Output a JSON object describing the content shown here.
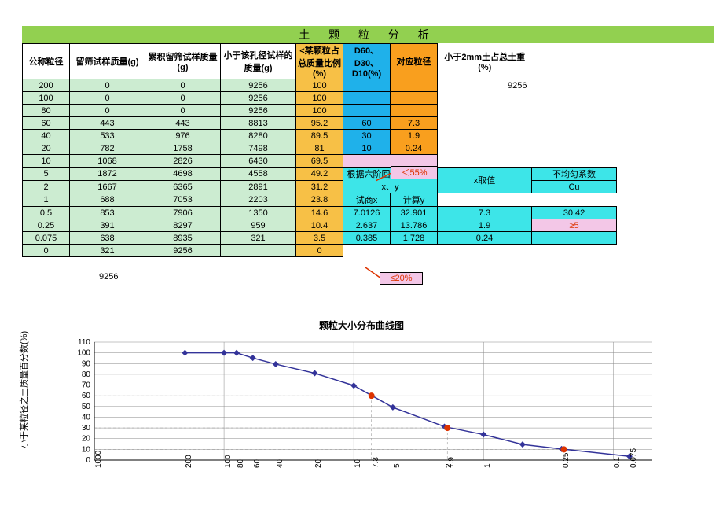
{
  "title": "土 颗 粒 分 析",
  "headers": {
    "nominal": "公称粒径",
    "retained": "留筛试样质量(g)",
    "cumretained": "累积留筛试样质量(g)",
    "passing": "小于该孔径试样的质量(g)",
    "pct": "<某颗粒占总质量比例(%)",
    "d": "D60、D30、D10(%)",
    "dia": "对应粒径",
    "soil": "小于2mm土占总土重(%)"
  },
  "total_under_header": "9256",
  "rows": [
    {
      "nom": "200",
      "ret": "0",
      "cum": "0",
      "pass": "9256",
      "pct": "100",
      "d": "",
      "dia": ""
    },
    {
      "nom": "100",
      "ret": "0",
      "cum": "0",
      "pass": "9256",
      "pct": "100",
      "d": "",
      "dia": ""
    },
    {
      "nom": "80",
      "ret": "0",
      "cum": "0",
      "pass": "9256",
      "pct": "100",
      "d": "",
      "dia": ""
    },
    {
      "nom": "60",
      "ret": "443",
      "cum": "443",
      "pass": "8813",
      "pct": "95.2",
      "d": "60",
      "dia": "7.3"
    },
    {
      "nom": "40",
      "ret": "533",
      "cum": "976",
      "pass": "8280",
      "pct": "89.5",
      "d": "30",
      "dia": "1.9"
    },
    {
      "nom": "20",
      "ret": "782",
      "cum": "1758",
      "pass": "7498",
      "pct": "81",
      "d": "10",
      "dia": "0.24"
    },
    {
      "nom": "10",
      "ret": "1068",
      "cum": "2826",
      "pass": "6430",
      "pct": "69.5",
      "d": "",
      "dia": ""
    },
    {
      "nom": "5",
      "ret": "1872",
      "cum": "4698",
      "pass": "4558",
      "pct": "49.2",
      "d": "",
      "dia": ""
    },
    {
      "nom": "2",
      "ret": "1667",
      "cum": "6365",
      "pass": "2891",
      "pct": "31.2",
      "d": "",
      "dia": ""
    },
    {
      "nom": "1",
      "ret": "688",
      "cum": "7053",
      "pass": "2203",
      "pct": "23.8",
      "d": "",
      "dia": ""
    },
    {
      "nom": "0.5",
      "ret": "853",
      "cum": "7906",
      "pass": "1350",
      "pct": "14.6",
      "d": "",
      "dia": ""
    },
    {
      "nom": "0.25",
      "ret": "391",
      "cum": "8297",
      "pass": "959",
      "pct": "10.4",
      "d": "",
      "dia": ""
    },
    {
      "nom": "0.075",
      "ret": "638",
      "cum": "8935",
      "pass": "321",
      "pct": "3.5",
      "d": "",
      "dia": ""
    },
    {
      "nom": "0",
      "ret": "321",
      "cum": "9256",
      "pass": "",
      "pct": "0",
      "d": "",
      "dia": ""
    }
  ],
  "sum_label": "9256",
  "regression_hdr": "根据六阶回归方程计算x、y",
  "trialx_hdr": "试商x",
  "calcy_hdr": "计算y",
  "xvalue_hdr": "x取值",
  "cu_hdr1": "不均匀系数",
  "cu_hdr2": "Cu",
  "calc_rows": [
    {
      "x": "7.0126",
      "y": "32.901",
      "xv": "7.3",
      "cu": "30.42"
    },
    {
      "x": "2.637",
      "y": "13.786",
      "xv": "1.9",
      "cu": "≥5"
    },
    {
      "x": "0.385",
      "y": "1.728",
      "xv": "0.24",
      "cu": ""
    }
  ],
  "annot_55": "＜55%",
  "annot_20": "≤20%",
  "chart_title": "颗粒大小分布曲线图",
  "y_axis_label": "小于某粒径之土质量百分数(%)",
  "chart_data": {
    "type": "line",
    "title": "颗粒大小分布曲线图",
    "xlabel": "",
    "ylabel": "小于某粒径之土质量百分数(%)",
    "xscale": "log-reverse",
    "ylim": [
      0,
      110
    ],
    "yticks": [
      0,
      10,
      20,
      30,
      40,
      50,
      60,
      70,
      80,
      90,
      100,
      110
    ],
    "series": [
      {
        "name": "percent_passing",
        "x": [
          200,
          100,
          80,
          60,
          40,
          20,
          10,
          5,
          2,
          1,
          0.5,
          0.25,
          0.075
        ],
        "y": [
          100,
          100,
          100,
          95.2,
          89.5,
          81,
          69.5,
          49.2,
          31.2,
          23.8,
          14.6,
          10.4,
          3.5
        ]
      }
    ],
    "reference_points": [
      {
        "name": "D60",
        "x": 7.3,
        "y": 60
      },
      {
        "name": "D30",
        "x": 1.9,
        "y": 30
      },
      {
        "name": "D10",
        "x": 0.24,
        "y": 10
      }
    ],
    "x_tick_labels": [
      "1000",
      "200",
      "100",
      "80",
      "60",
      "40",
      "20",
      "10",
      "7.3",
      "5",
      "2",
      "1.9",
      "1",
      "0.25",
      "0.1",
      "0.075"
    ]
  }
}
